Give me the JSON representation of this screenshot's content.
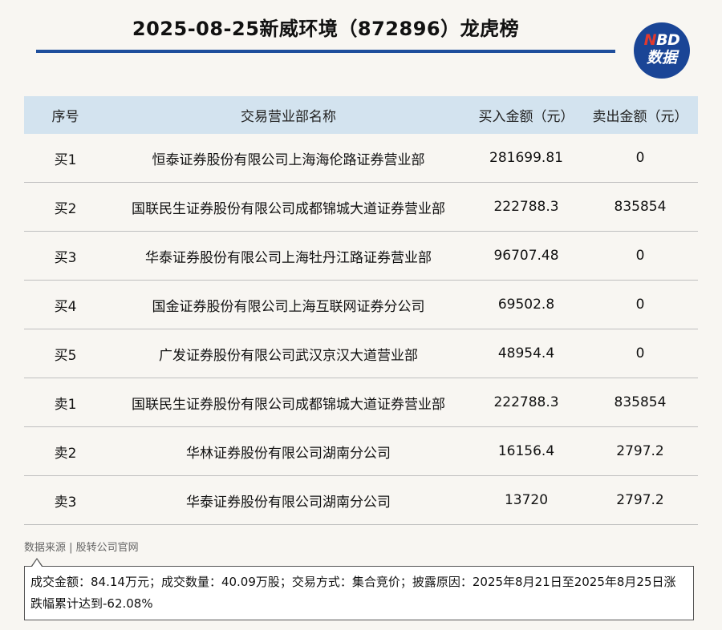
{
  "title": "2025-08-25新威环境（872896）龙虎榜",
  "logo": {
    "line1_n": "N",
    "line1_rest": "BD",
    "line2": "数据"
  },
  "colors": {
    "accent": "#1f4e9c",
    "header_bg": "#d3e3ef",
    "logo_bg": "#1a4596",
    "logo_red": "#e23a2e"
  },
  "table": {
    "headers": [
      "序号",
      "交易营业部名称",
      "买入金额（元）",
      "卖出金额（元）"
    ],
    "rows": [
      [
        "买1",
        "恒泰证券股份有限公司上海海伦路证券营业部",
        "281699.81",
        "0"
      ],
      [
        "买2",
        "国联民生证券股份有限公司成都锦城大道证券营业部",
        "222788.3",
        "835854"
      ],
      [
        "买3",
        "华泰证券股份有限公司上海牡丹江路证券营业部",
        "96707.48",
        "0"
      ],
      [
        "买4",
        "国金证券股份有限公司上海互联网证券分公司",
        "69502.8",
        "0"
      ],
      [
        "买5",
        "广发证券股份有限公司武汉京汉大道营业部",
        "48954.4",
        "0"
      ],
      [
        "卖1",
        "国联民生证券股份有限公司成都锦城大道证券营业部",
        "222788.3",
        "835854"
      ],
      [
        "卖2",
        "华林证券股份有限公司湖南分公司",
        "16156.4",
        "2797.2"
      ],
      [
        "卖3",
        "华泰证券股份有限公司湖南分公司",
        "13720",
        "2797.2"
      ]
    ]
  },
  "source": "数据来源 | 股转公司官网",
  "note": "成交金额：84.14万元；成交数量：40.09万股；交易方式：集合竞价；披露原因：2025年8月21日至2025年8月25日涨跌幅累计达到-62.08%"
}
